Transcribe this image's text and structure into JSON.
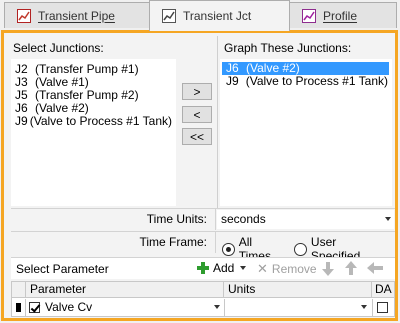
{
  "tabs": [
    {
      "label": "Transient Pipe",
      "icon": "red-line-chart-icon",
      "active": false
    },
    {
      "label": "Transient Jct",
      "icon": "gray-line-chart-icon",
      "active": true
    },
    {
      "label": "Profile",
      "icon": "purple-line-chart-icon",
      "active": false
    }
  ],
  "select_junctions": {
    "heading": "Select Junctions:",
    "items": [
      {
        "id": "J2",
        "name": "(Transfer Pump #1)"
      },
      {
        "id": "J3",
        "name": "(Valve #1)"
      },
      {
        "id": "J5",
        "name": "(Transfer Pump #2)"
      },
      {
        "id": "J6",
        "name": "(Valve #2)"
      },
      {
        "id": "J9",
        "name": "(Valve to Process #1 Tank)"
      }
    ]
  },
  "transfer_buttons": {
    "add": ">",
    "remove": "<",
    "remove_all": "<<"
  },
  "graph_junctions": {
    "heading": "Graph These Junctions:",
    "items": [
      {
        "id": "J6",
        "name": "(Valve #2)",
        "selected": true
      },
      {
        "id": "J9",
        "name": "(Valve to Process #1 Tank)",
        "selected": false
      }
    ]
  },
  "time_units": {
    "label": "Time Units:",
    "value": "seconds"
  },
  "time_frame": {
    "label": "Time Frame:",
    "options": [
      "All Times",
      "User Specified"
    ],
    "selected": "All Times"
  },
  "select_parameter": {
    "title": "Select Parameter",
    "add_label": "Add",
    "remove_label": "Remove"
  },
  "param_grid": {
    "columns": [
      "Parameter",
      "Units",
      "DA"
    ],
    "rows": [
      {
        "checked": true,
        "parameter": "Valve Cv",
        "units": "",
        "da": false
      }
    ]
  },
  "colors": {
    "frame_accent": "#f5a623",
    "selection": "#3399ff",
    "add_icon": "#2e9c2e"
  }
}
